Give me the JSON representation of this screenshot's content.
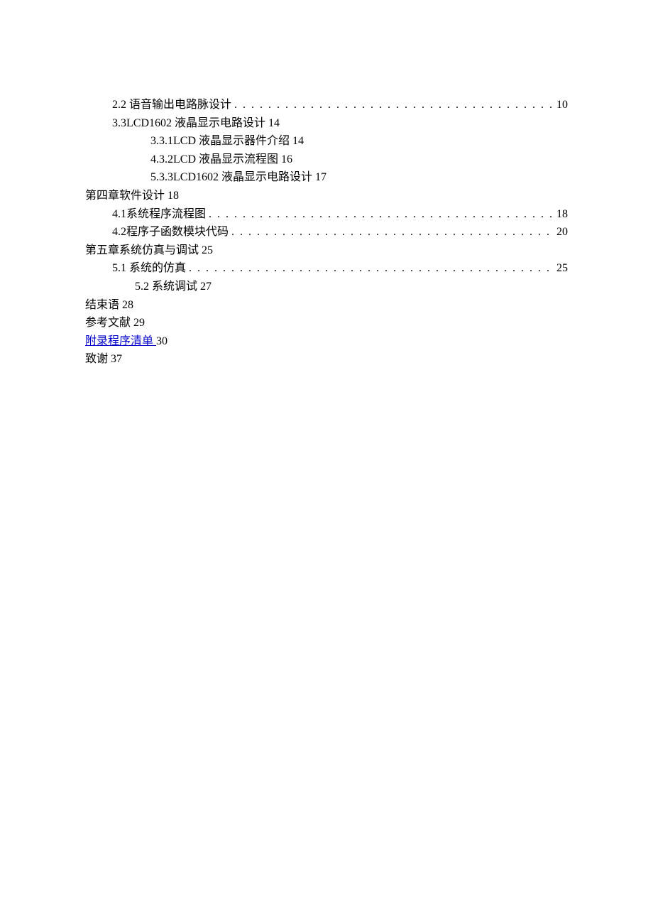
{
  "lines": [
    {
      "style": "indent-1",
      "num": "2",
      "text": ".2 语音输出电路脉设计",
      "dots": true,
      "page": "10"
    },
    {
      "style": "indent-1",
      "num": "3",
      "text": ".3LCD1602 液晶显示电路设计 14",
      "dots": false,
      "page": ""
    },
    {
      "style": "indent-2",
      "num": "3. ",
      "text": "3.1LCD 液晶显示器件介绍 14",
      "dots": false,
      "page": ""
    },
    {
      "style": "indent-2",
      "num": "4. ",
      "text": "3.2LCD 液晶显示流程图 16",
      "dots": false,
      "page": ""
    },
    {
      "style": "indent-2",
      "num": "5. ",
      "text": "3.3LCD1602 液晶显示电路设计 17",
      "dots": false,
      "page": ""
    },
    {
      "style": "",
      "num": "",
      "text": "第四章软件设计 18",
      "dots": false,
      "page": ""
    },
    {
      "style": "indent-3",
      "num": "4.1",
      "text": "   系统程序流程图",
      "dots": true,
      "page": "18"
    },
    {
      "style": "indent-3",
      "num": "4.2",
      "text": "   程序子函数模块代码",
      "dots": true,
      "page": "20"
    },
    {
      "style": "",
      "num": "",
      "text": "第五章系统仿真与调试 25",
      "dots": false,
      "page": ""
    },
    {
      "style": "indent-3",
      "num": "5. ",
      "text": "1 系统的仿真",
      "dots": true,
      "page": "25"
    },
    {
      "style": "indent-3b",
      "num": "",
      "text": "5.2 系统调试 27",
      "dots": false,
      "page": ""
    },
    {
      "style": "",
      "num": "",
      "text": "结束语 28",
      "dots": false,
      "page": ""
    },
    {
      "style": "",
      "num": "",
      "text": "参考文献 29",
      "dots": false,
      "page": ""
    },
    {
      "style": "",
      "num": "",
      "text": "附录程序清单 ",
      "link": true,
      "suffix": "30",
      "dots": false,
      "page": ""
    },
    {
      "style": "",
      "num": "",
      "text": "致谢 37",
      "dots": false,
      "page": ""
    }
  ]
}
